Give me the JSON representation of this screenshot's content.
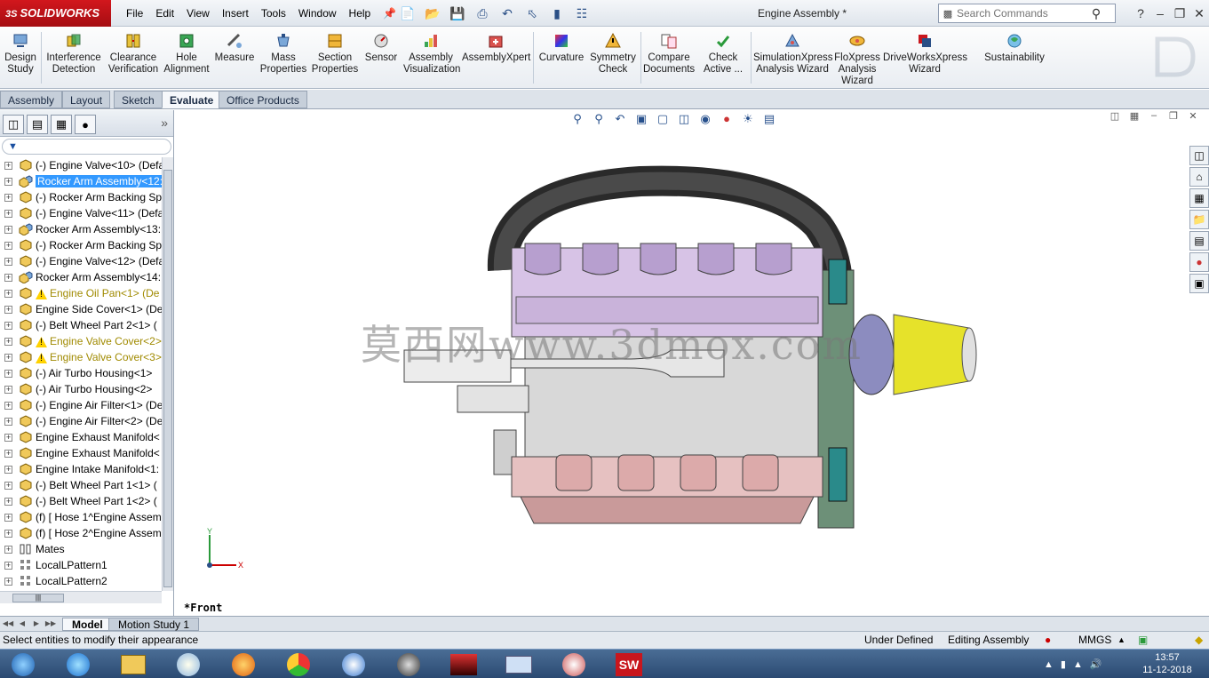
{
  "app": {
    "brand": "SOLIDWORKS",
    "brand_prefix": "3S",
    "menus": [
      "File",
      "Edit",
      "View",
      "Insert",
      "Tools",
      "Window",
      "Help"
    ],
    "document_title": "Engine Assembly *",
    "search_placeholder": "Search Commands"
  },
  "commands": {
    "design_study": "Design Study",
    "interference": "Interference Detection",
    "clearance": "Clearance Verification",
    "hole_alignment": "Hole Alignment",
    "measure": "Measure",
    "mass_properties": "Mass Properties",
    "section_properties": "Section Properties",
    "sensor": "Sensor",
    "assembly_visualization": "Assembly Visualization",
    "assemblyxpert": "AssemblyXpert",
    "curvature": "Curvature",
    "symmetry_check": "Symmetry Check",
    "compare_documents": "Compare Documents",
    "check_active": "Check Active ...",
    "simulationxpress": "SimulationXpress Analysis Wizard",
    "floxpress": "FloXpress Analysis Wizard",
    "driveworksxpress": "DriveWorksXpress Wizard",
    "sustainability": "Sustainability"
  },
  "cm_tabs": [
    "Assembly",
    "Layout",
    "Sketch",
    "Evaluate",
    "Office Products"
  ],
  "feature_tree": [
    {
      "label": "(-) Engine Valve<10> (Defa",
      "icon": "part-icon"
    },
    {
      "label": "Rocker Arm Assembly<12:",
      "icon": "subassembly-icon",
      "selected": true
    },
    {
      "label": "(-) Rocker Arm Backing Sp",
      "icon": "part-icon"
    },
    {
      "label": "(-) Engine Valve<11> (Defa",
      "icon": "part-icon"
    },
    {
      "label": "Rocker Arm Assembly<13:",
      "icon": "subassembly-icon"
    },
    {
      "label": "(-) Rocker Arm Backing Sp",
      "icon": "part-icon"
    },
    {
      "label": "(-) Engine Valve<12> (Defa",
      "icon": "part-icon"
    },
    {
      "label": "Rocker Arm Assembly<14:",
      "icon": "subassembly-icon"
    },
    {
      "label": "Engine Oil Pan<1> (De",
      "icon": "part-icon",
      "warning": true
    },
    {
      "label": "Engine Side Cover<1> (De",
      "icon": "part-icon"
    },
    {
      "label": "(-) Belt Wheel Part  2<1> (",
      "icon": "part-icon"
    },
    {
      "label": "Engine Valve Cover<2>",
      "icon": "part-icon",
      "warning": true
    },
    {
      "label": "Engine Valve Cover<3>",
      "icon": "part-icon",
      "warning": true
    },
    {
      "label": "(-) Air Turbo Housing<1>",
      "icon": "part-icon"
    },
    {
      "label": "(-) Air Turbo Housing<2>",
      "icon": "part-icon"
    },
    {
      "label": "(-) Engine Air Filter<1> (De",
      "icon": "part-icon"
    },
    {
      "label": "(-) Engine Air Filter<2> (De",
      "icon": "part-icon"
    },
    {
      "label": "Engine Exhaust Manifold<",
      "icon": "part-icon"
    },
    {
      "label": "Engine Exhaust Manifold<",
      "icon": "part-icon"
    },
    {
      "label": "Engine Intake Manifold<1:",
      "icon": "part-icon"
    },
    {
      "label": "(-) Belt Wheel Part  1<1> (",
      "icon": "part-icon"
    },
    {
      "label": "(-) Belt Wheel Part  1<2> (",
      "icon": "part-icon"
    },
    {
      "label": "(f) [ Hose 1^Engine Assem",
      "icon": "part-icon"
    },
    {
      "label": "(f) [ Hose 2^Engine Assem",
      "icon": "part-icon"
    },
    {
      "label": "Mates",
      "icon": "mates-icon"
    },
    {
      "label": "LocalLPattern1",
      "icon": "pattern-icon"
    },
    {
      "label": "LocalLPattern2",
      "icon": "pattern-icon"
    }
  ],
  "viewport": {
    "view_name": "*Front",
    "watermark": "莫西网www.3dmox.com",
    "triad_x": "X",
    "triad_y": "Y"
  },
  "bottom_tabs": [
    "Model",
    "Motion Study 1"
  ],
  "status": {
    "message": "Select entities to modify their appearance",
    "definition": "Under Defined",
    "mode": "Editing Assembly",
    "units": "MMGS"
  },
  "taskbar": {
    "time": "13:57",
    "date": "11-12-2018"
  },
  "colors": {
    "brand_red": "#c8161d",
    "selection_blue": "#3399ff",
    "warning_text": "#a08a00"
  }
}
